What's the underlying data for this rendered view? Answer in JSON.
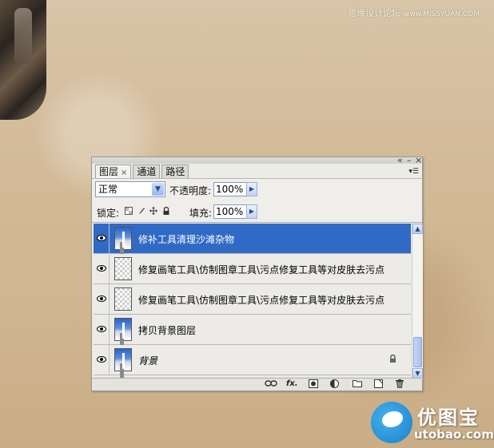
{
  "watermark": {
    "cn": "思缘设计论坛",
    "site": "www.MISSYUAN.COM"
  },
  "window_controls": {
    "collapse": "«",
    "minimize": "–",
    "close": "×"
  },
  "tabs": [
    {
      "label": "图层",
      "close": "×",
      "active": true
    },
    {
      "label": "通道",
      "active": false
    },
    {
      "label": "路径",
      "active": false
    }
  ],
  "blend": {
    "mode": "正常",
    "opacity_label": "不透明度:",
    "opacity": "100%"
  },
  "lock": {
    "label": "锁定:",
    "fill_label": "填充:",
    "fill": "100%"
  },
  "layers": [
    {
      "name": "修补工具清理沙滩杂物",
      "selected": true,
      "thumb": "photo"
    },
    {
      "name": "修复画笔工具\\仿制图章工具\\污点修复工具等对皮肤去污点",
      "selected": false,
      "thumb": "transparent"
    },
    {
      "name": "修复画笔工具\\仿制图章工具\\污点修复工具等对皮肤去污点",
      "selected": false,
      "thumb": "transparent"
    },
    {
      "name": "拷贝背景图层",
      "selected": false,
      "thumb": "photo"
    },
    {
      "name": "背景",
      "selected": false,
      "thumb": "photo",
      "locked": true
    }
  ],
  "bottom_icons": [
    "link-layers-icon",
    "fx-icon",
    "add-mask-icon",
    "adjustment-layer-icon",
    "new-group-icon",
    "new-layer-icon",
    "delete-layer-icon"
  ],
  "bottom": {
    "fx": "fx."
  },
  "brand": {
    "cn": "优图宝",
    "url": "utobao.com"
  }
}
